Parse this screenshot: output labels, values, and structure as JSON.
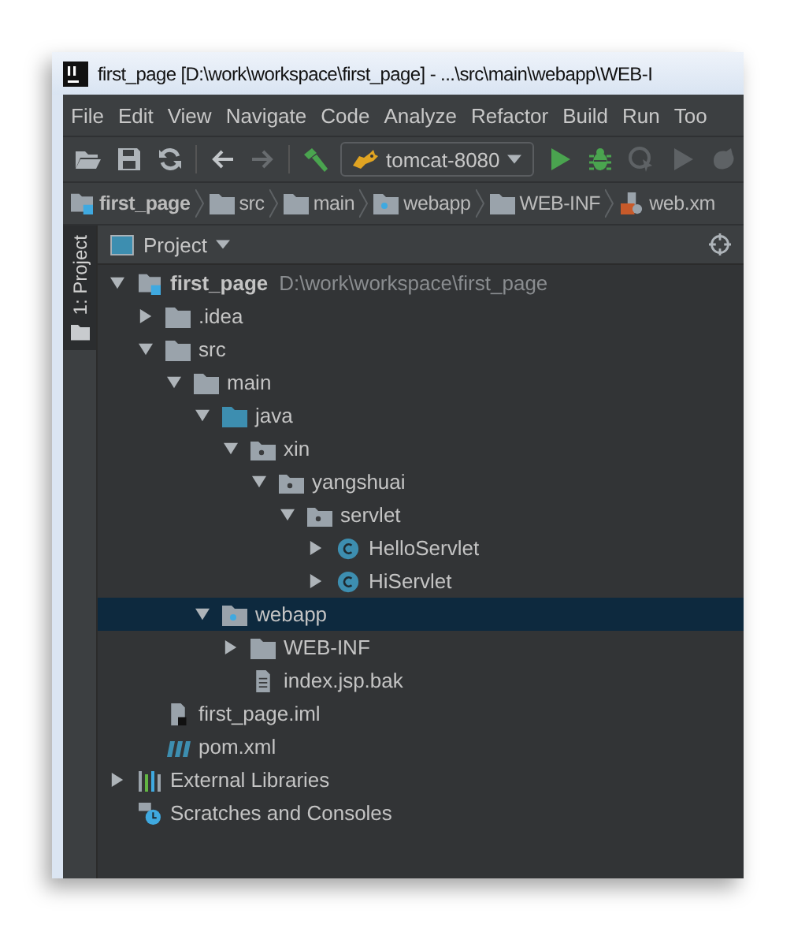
{
  "window": {
    "title": "first_page [D:\\work\\workspace\\first_page] - ...\\src\\main\\webapp\\WEB-I"
  },
  "menu": [
    "File",
    "Edit",
    "View",
    "Navigate",
    "Code",
    "Analyze",
    "Refactor",
    "Build",
    "Run",
    "Too"
  ],
  "toolbar": {
    "run_configuration": "tomcat-8080"
  },
  "breadcrumbs": [
    {
      "label": "first_page",
      "kind": "module"
    },
    {
      "label": "src",
      "kind": "folder"
    },
    {
      "label": "main",
      "kind": "folder"
    },
    {
      "label": "webapp",
      "kind": "web"
    },
    {
      "label": "WEB-INF",
      "kind": "folder"
    },
    {
      "label": "web.xm",
      "kind": "xml"
    }
  ],
  "side_tab": {
    "label": "1: Project"
  },
  "project_panel": {
    "title": "Project"
  },
  "tree": [
    {
      "name": "first_page",
      "kind": "module",
      "path": "D:\\work\\workspace\\first_page",
      "expanded": true,
      "selected": false,
      "children": [
        {
          "name": ".idea",
          "kind": "folder",
          "expanded": false,
          "selected": false
        },
        {
          "name": "src",
          "kind": "folder",
          "expanded": true,
          "selected": false,
          "children": [
            {
              "name": "main",
              "kind": "folder",
              "expanded": true,
              "selected": false,
              "children": [
                {
                  "name": "java",
                  "kind": "source",
                  "expanded": true,
                  "selected": false,
                  "children": [
                    {
                      "name": "xin",
                      "kind": "package",
                      "expanded": true,
                      "selected": false,
                      "children": [
                        {
                          "name": "yangshuai",
                          "kind": "package",
                          "expanded": true,
                          "selected": false,
                          "children": [
                            {
                              "name": "servlet",
                              "kind": "package",
                              "expanded": true,
                              "selected": false,
                              "children": [
                                {
                                  "name": "HelloServlet",
                                  "kind": "class",
                                  "expanded": false,
                                  "selected": false
                                },
                                {
                                  "name": "HiServlet",
                                  "kind": "class",
                                  "expanded": false,
                                  "selected": false
                                }
                              ]
                            }
                          ]
                        }
                      ]
                    }
                  ]
                },
                {
                  "name": "webapp",
                  "kind": "web",
                  "expanded": true,
                  "selected": true,
                  "children": [
                    {
                      "name": "WEB-INF",
                      "kind": "folder",
                      "expanded": false,
                      "selected": false
                    },
                    {
                      "name": "index.jsp.bak",
                      "kind": "file",
                      "selected": false
                    }
                  ]
                }
              ]
            }
          ]
        },
        {
          "name": "first_page.iml",
          "kind": "iml",
          "selected": false
        },
        {
          "name": "pom.xml",
          "kind": "maven",
          "selected": false
        }
      ]
    },
    {
      "name": "External Libraries",
      "kind": "libraries",
      "expanded": false,
      "selected": false
    },
    {
      "name": "Scratches and Consoles",
      "kind": "scratches",
      "selected": false
    }
  ]
}
